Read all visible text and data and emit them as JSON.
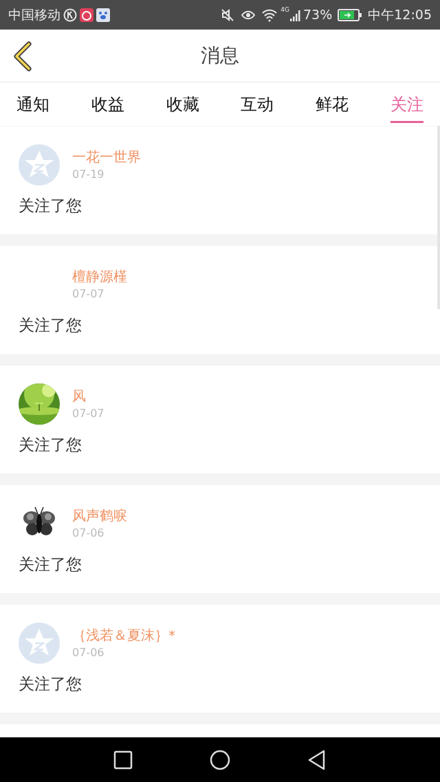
{
  "status_bar": {
    "carrier": "中国移动",
    "network": "4G",
    "battery": "73%",
    "time": "中午12:05"
  },
  "header": {
    "title": "消息"
  },
  "tabs": [
    {
      "label": "通知",
      "selected": false
    },
    {
      "label": "收益",
      "selected": false
    },
    {
      "label": "收藏",
      "selected": false
    },
    {
      "label": "互动",
      "selected": false
    },
    {
      "label": "鲜花",
      "selected": false
    },
    {
      "label": "关注",
      "selected": true
    }
  ],
  "messages": [
    {
      "avatar": {
        "kind": "default"
      },
      "name": "一花一世界",
      "date": "07-19",
      "text": "关注了您"
    },
    {
      "avatar": {
        "kind": "blank"
      },
      "name": "檀静源槿",
      "date": "07-07",
      "text": "关注了您"
    },
    {
      "name": "风",
      "date": "07-07",
      "text": "关注了您"
    },
    {
      "avatar": {
        "kind": "butterfly"
      },
      "name": "风声鹤唳",
      "date": "07-06",
      "text": "关注了您"
    },
    {
      "avatar": {
        "kind": "default"
      },
      "name": "｛浅若＆夏沫｝*",
      "date": "07-06",
      "text": "关注了您"
    }
  ]
}
